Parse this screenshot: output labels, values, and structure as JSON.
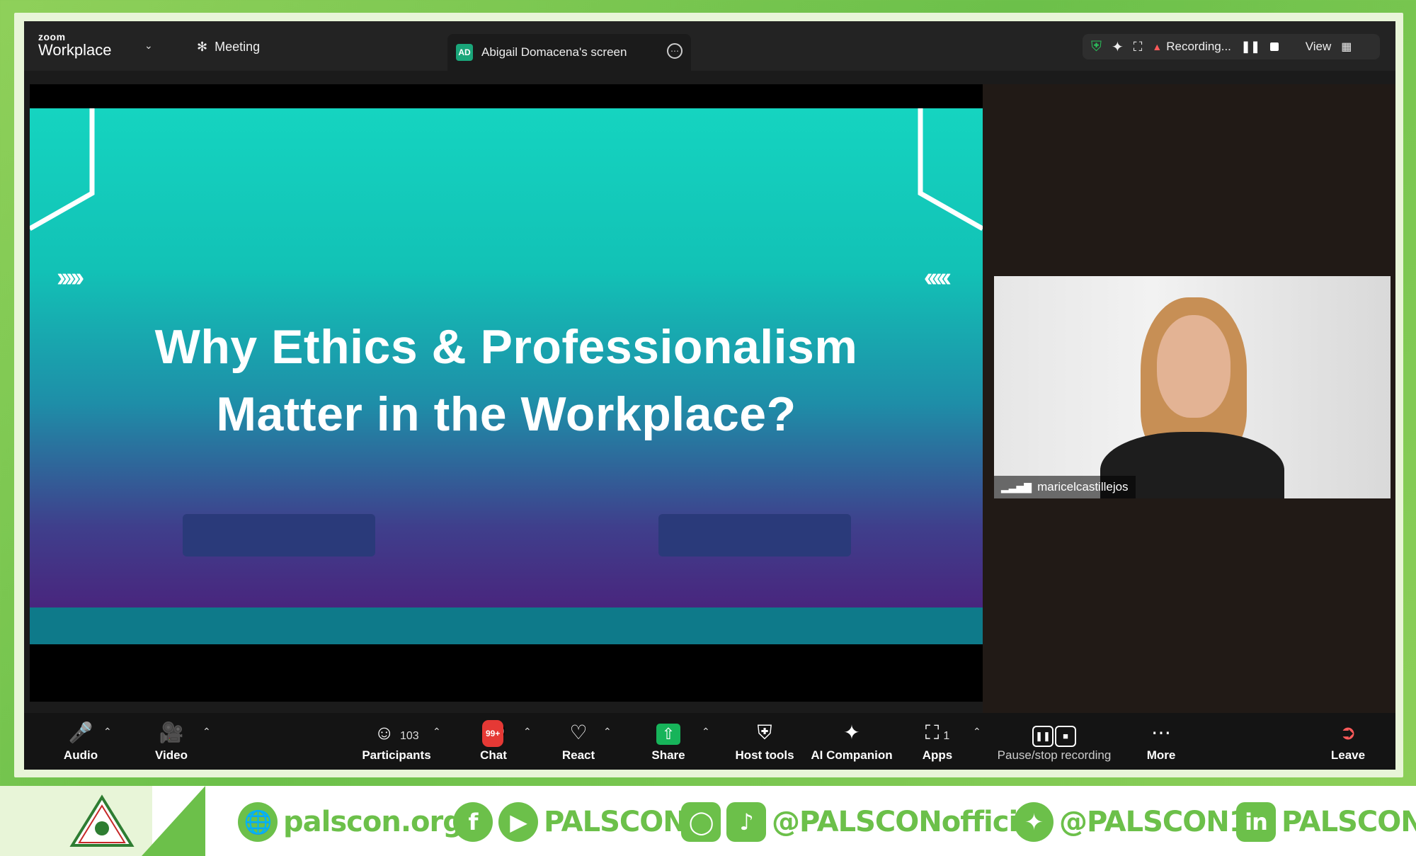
{
  "app": {
    "brand_small": "zoom",
    "brand_large": "Workplace",
    "meeting_label": "Meeting"
  },
  "share": {
    "initials": "AD",
    "title": "Abigail Domacena's screen"
  },
  "status": {
    "recording_label": "Recording...",
    "view_label": "View"
  },
  "slide": {
    "title_line1": "Why Ethics & Professionalism",
    "title_line2": "Matter in the Workplace?",
    "left_arrows": "›››››",
    "right_arrows": "‹‹‹‹‹"
  },
  "participant": {
    "name": "maricelcastillejos"
  },
  "toolbar": {
    "audio": "Audio",
    "video": "Video",
    "participants": "Participants",
    "participants_count": "103",
    "chat": "Chat",
    "chat_badge": "99+",
    "react": "React",
    "share": "Share",
    "host_tools": "Host tools",
    "ai_companion": "AI Companion",
    "apps": "Apps",
    "apps_count": "1",
    "pause_stop": "Pause/stop recording",
    "more": "More",
    "leave": "Leave"
  },
  "footer": {
    "website": "palscon.org",
    "fb_yt": "PALSCON",
    "ig_tt": "@PALSCONofficial",
    "twitter": "@PALSCON1",
    "linkedin": "PALSCON"
  },
  "colors": {
    "accent_green": "#6cc04a",
    "share_green": "#17b45a",
    "slide_teal": "#15d4c0",
    "slide_purple": "#4d1a77"
  }
}
